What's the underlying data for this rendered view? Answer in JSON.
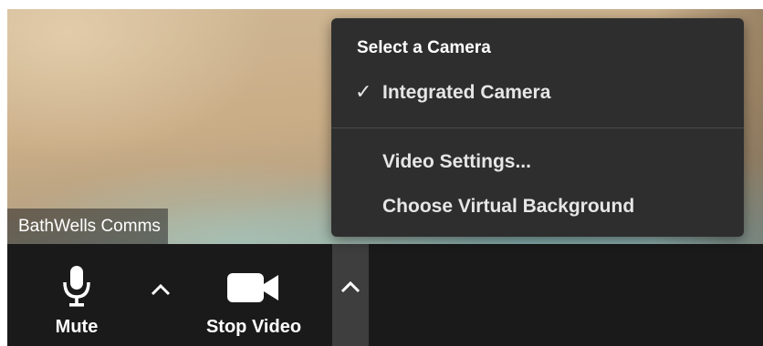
{
  "participant": {
    "name": "BathWells Comms"
  },
  "toolbar": {
    "mute_label": "Mute",
    "stop_video_label": "Stop Video"
  },
  "camera_menu": {
    "header": "Select a Camera",
    "items": [
      {
        "label": "Integrated Camera",
        "checked": true
      },
      {
        "label": "Video Settings..."
      },
      {
        "label": "Choose Virtual Background"
      }
    ],
    "checkmark": "✓"
  },
  "icons": {
    "mic": "microphone-icon",
    "video": "video-camera-icon",
    "chevron": "chevron-up-icon"
  },
  "colors": {
    "toolbar_bg": "#1a1a1a",
    "menu_bg": "#2e2e2e",
    "chevron_active_bg": "#3e3e3e"
  }
}
